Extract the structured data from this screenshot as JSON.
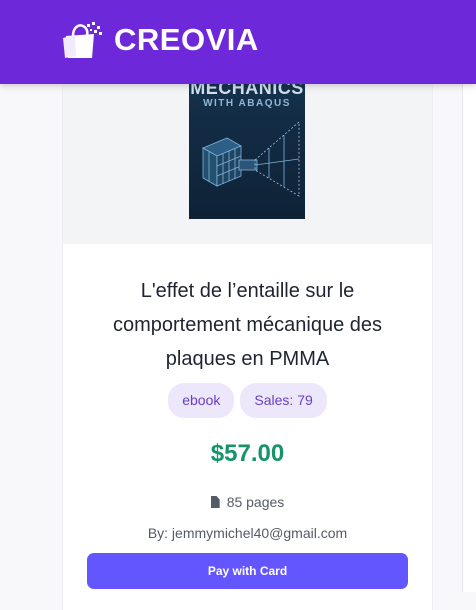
{
  "brand": {
    "name": "CREOVIA",
    "logo_icon": "shopping-bag-icon",
    "header_color": "#6d28d9"
  },
  "product": {
    "cover": {
      "title": "MECHANICS",
      "subtitle": "WITH ABAQUS"
    },
    "title": "L'effet de l’entaille sur le comportement mécanique des plaques en PMMA",
    "type_badge": "ebook",
    "sales_badge": "Sales: 79",
    "price": "$57.00",
    "pages": "85 pages",
    "author": "By: jemmymichel40@gmail.com",
    "pay_label": "Pay with Card",
    "price_color": "#15946a",
    "button_color": "#6356ff"
  }
}
